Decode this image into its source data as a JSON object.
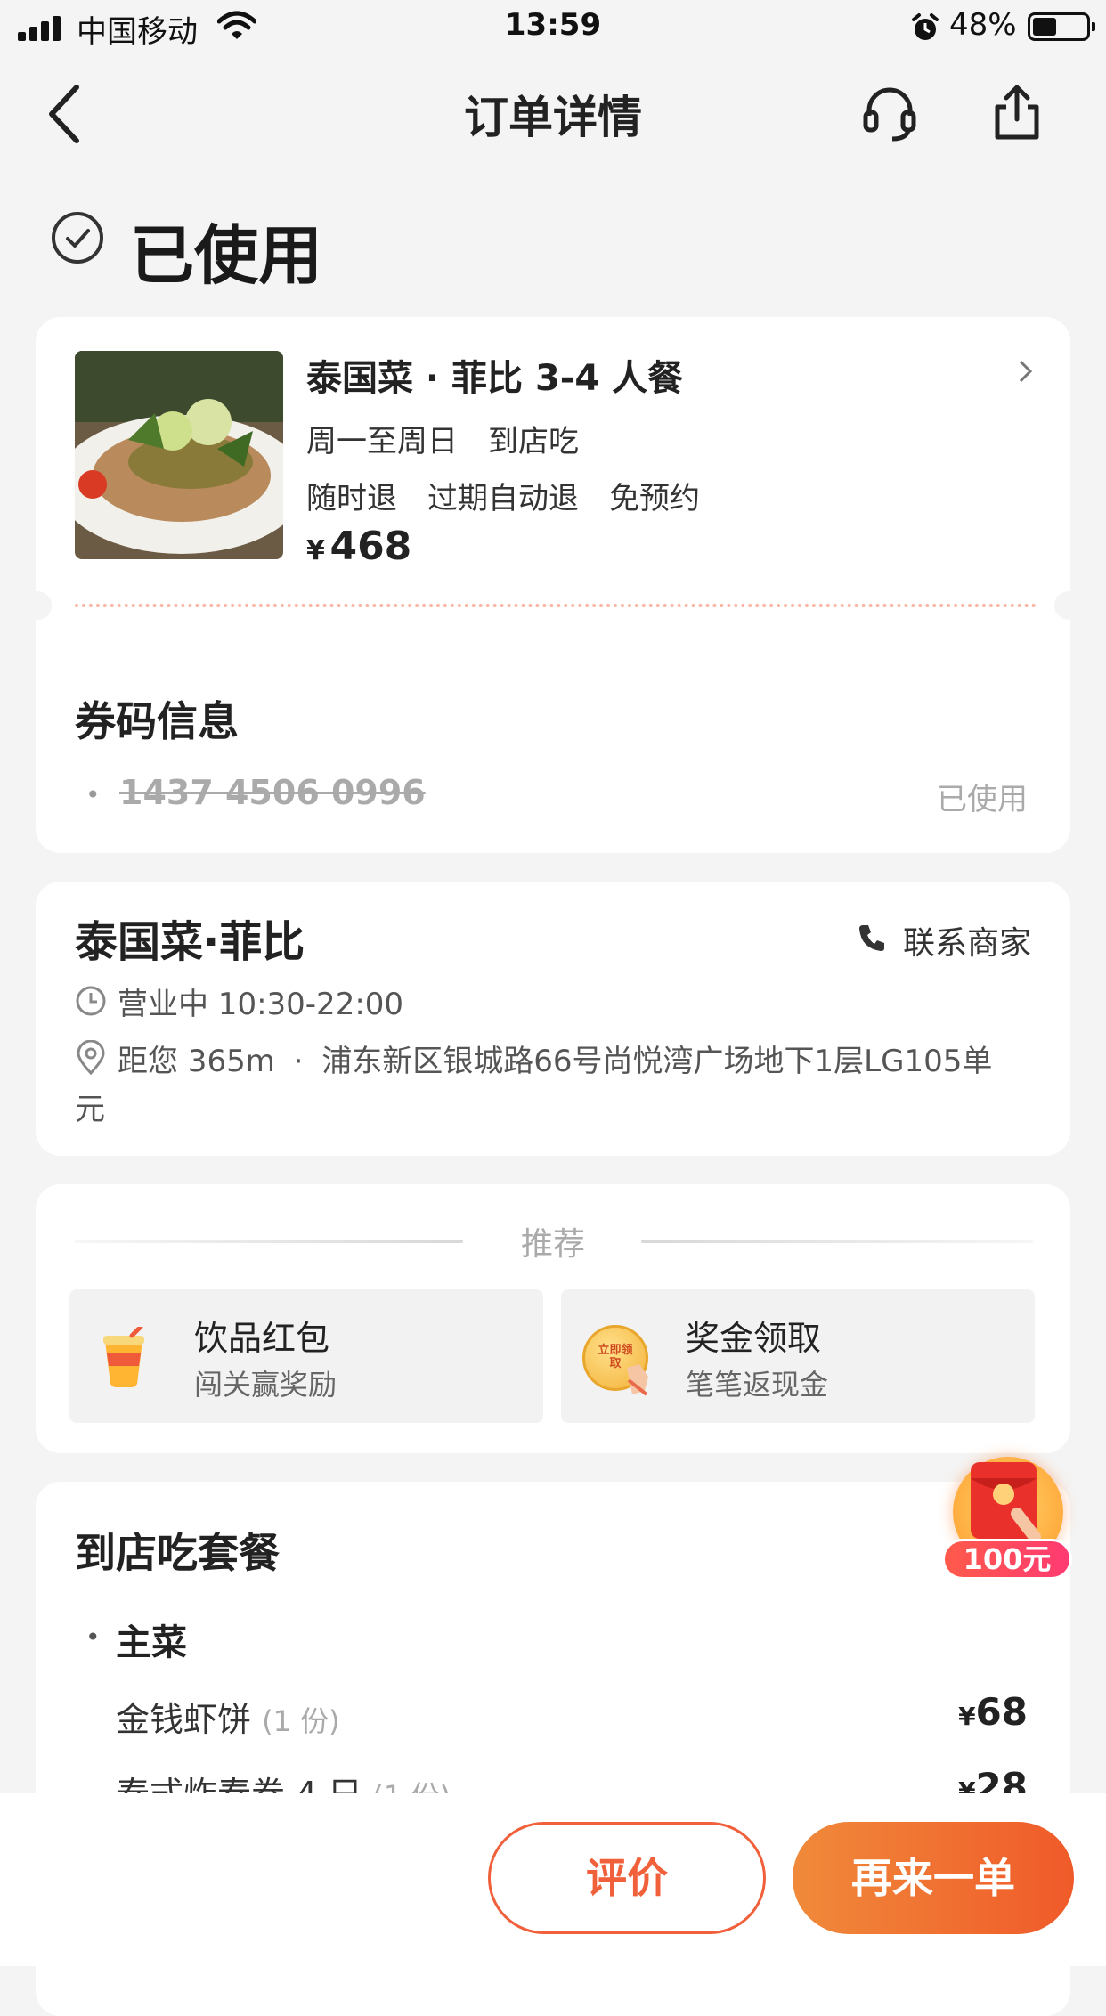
{
  "status_bar": {
    "carrier": "中国移动",
    "time": "13:59",
    "battery": "48%"
  },
  "nav": {
    "title": "订单详情"
  },
  "order_status": {
    "label": "已使用"
  },
  "product": {
    "name": "泰国菜 · 菲比 3-4 人餐",
    "days": "周一至周日",
    "mode": "到店吃",
    "tags": [
      "随时退",
      "过期自动退",
      "免预约"
    ],
    "currency": "¥",
    "price": "468"
  },
  "voucher": {
    "title": "券码信息",
    "code": "1437 4506 0996",
    "status": "已使用"
  },
  "store": {
    "name": "泰国菜·菲比",
    "contact_label": "联系商家",
    "hours": "营业中 10:30-22:00",
    "distance": "距您 365m",
    "address_line1": "浦东新区银城路66号尚悦湾广场地下1层LG105单",
    "address_line2": "元"
  },
  "recommend": {
    "title": "推荐",
    "items": [
      {
        "title": "饮品红包",
        "subtitle": "闯关赢奖励"
      },
      {
        "title": "奖金领取",
        "subtitle": "笔笔返现金",
        "badge": "立即领取"
      }
    ]
  },
  "floating_promo": {
    "label": "100元"
  },
  "package": {
    "title": "到店吃套餐",
    "section": "主菜",
    "items": [
      {
        "name": "金钱虾饼",
        "qty": "(1 份)",
        "currency": "¥",
        "price": "68"
      },
      {
        "name": "泰式炸春卷 4 只",
        "qty": "(1 份)",
        "currency": "¥",
        "price": "28"
      }
    ]
  },
  "actions": {
    "review": "评价",
    "reorder": "再来一单"
  }
}
